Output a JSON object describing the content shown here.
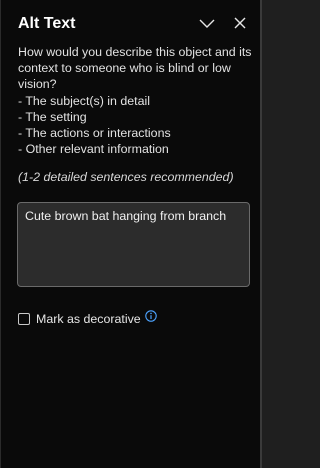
{
  "panel": {
    "title": "Alt Text",
    "collapse_icon": "chevron-down-icon",
    "close_icon": "close-icon"
  },
  "description": {
    "lines": [
      "How would you describe this object and its",
      "context to someone who is blind or low",
      "vision?",
      "- The subject(s) in detail",
      "- The setting",
      "- The actions or interactions",
      "- Other relevant information"
    ]
  },
  "hint": "(1-2 detailed sentences recommended)",
  "alt_text": {
    "value": "Cute brown bat hanging from branch"
  },
  "decorative": {
    "label": "Mark as decorative",
    "checked": false,
    "info_icon": "info-icon"
  },
  "colors": {
    "panel_background": "#0a0a0a",
    "input_background": "#2c2c2c",
    "info_accent": "#4da3ff"
  }
}
